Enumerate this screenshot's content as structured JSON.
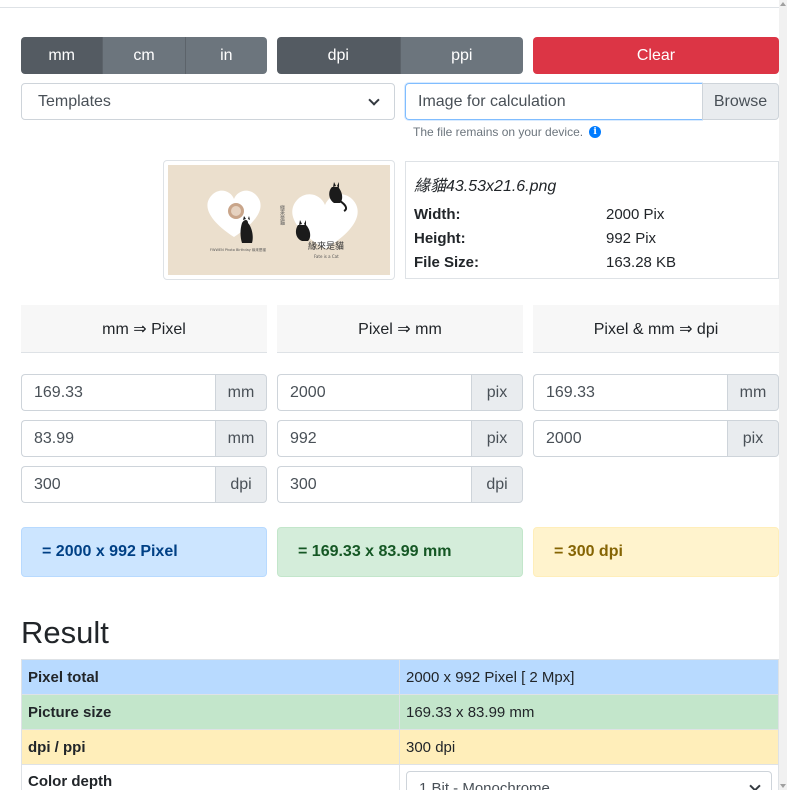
{
  "units": {
    "mm": "mm",
    "cm": "cm",
    "in": "in",
    "active": "mm"
  },
  "res_units": {
    "dpi": "dpi",
    "ppi": "ppi",
    "active": "dpi"
  },
  "clear_label": "Clear",
  "templates": {
    "selected": "Templates"
  },
  "file_input": {
    "placeholder": "Image for calculation",
    "browse_label": "Browse"
  },
  "hint": {
    "text": "The file remains on your device.",
    "icon": "info-icon"
  },
  "thumbnail": {
    "caption_small": "FWWEN Photo Birthday 緣來是貓",
    "caption_big": "緣來是貓",
    "caption_sub": "Fate is a Cat",
    "vertical_text": "緣來是貓",
    "colors": {
      "background": "#ebdfcd",
      "heart": "#ffffff",
      "cat": "#1b1b1b"
    }
  },
  "file_info": {
    "name": "緣貓43.53x21.6.png",
    "rows": [
      {
        "key": "Width:",
        "value": "2000 Pix"
      },
      {
        "key": "Height:",
        "value": "992 Pix"
      },
      {
        "key": "File Size:",
        "value": "163.28 KB"
      }
    ]
  },
  "columns": {
    "mm_to_pixel": {
      "title": "mm ⇒ Pixel",
      "inputs": [
        {
          "value": "169.33",
          "unit": "mm"
        },
        {
          "value": "83.99",
          "unit": "mm"
        },
        {
          "value": "300",
          "unit": "dpi"
        }
      ],
      "result": "= 2000 x 992 Pixel"
    },
    "pixel_to_mm": {
      "title": "Pixel ⇒ mm",
      "inputs": [
        {
          "value": "2000",
          "unit": "pix"
        },
        {
          "value": "992",
          "unit": "pix"
        },
        {
          "value": "300",
          "unit": "dpi"
        }
      ],
      "result": "= 169.33 x 83.99 mm"
    },
    "pixel_mm_to_dpi": {
      "title": "Pixel & mm ⇒ dpi",
      "inputs": [
        {
          "value": "169.33",
          "unit": "mm"
        },
        {
          "value": "2000",
          "unit": "pix"
        }
      ],
      "result": "= 300 dpi"
    }
  },
  "result": {
    "title": "Result",
    "rows": [
      {
        "key": "Pixel total",
        "value": "2000 x 992 Pixel [ 2 Mpx]"
      },
      {
        "key": "Picture size",
        "value": "169.33 x 83.99 mm"
      },
      {
        "key": "dpi / ppi",
        "value": "300 dpi"
      },
      {
        "key": "Color depth",
        "value": "1 Bit - Monochrome"
      }
    ]
  }
}
